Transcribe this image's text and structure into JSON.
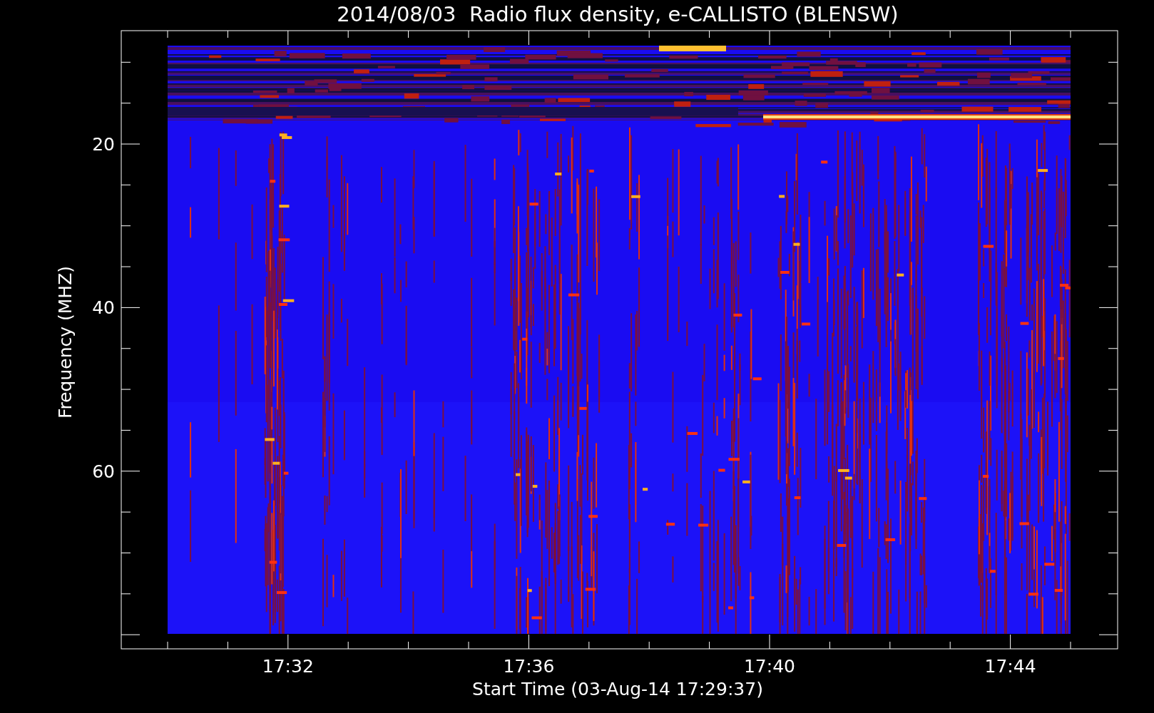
{
  "plot": {
    "title": "2014/08/03  Radio flux density, e-CALLISTO (BLENSW)",
    "xlabel": "Start Time (03-Aug-14 17:29:37)",
    "ylabel": "Frequency (MHZ)",
    "x_tick_labels": [
      "17:32",
      "17:36",
      "17:40",
      "17:44"
    ],
    "y_tick_labels": [
      "20",
      "40",
      "60"
    ]
  }
}
